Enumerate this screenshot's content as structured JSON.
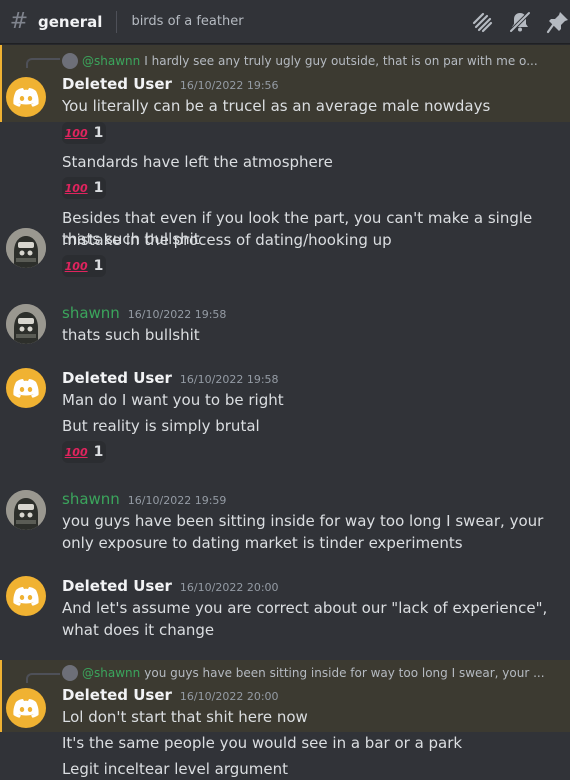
{
  "channel": {
    "name": "general",
    "topic": "birds of a feather"
  },
  "toolbar": {
    "icons": [
      "threads-icon",
      "notifications-muted-icon",
      "pin-icon"
    ]
  },
  "reactions": {
    "emoji": "100",
    "count": "1"
  },
  "messages": [
    {
      "reply": {
        "mention": "@shawnn",
        "text": "I hardly see any truly ugly guy outside, that is on par with me o..."
      },
      "author": "Deleted User",
      "time": "16/10/2022 19:56",
      "lines": [
        {
          "text": "You literally can be a trucel as an average male nowdays",
          "reaction": "1"
        },
        {
          "text": "Standards have left the atmosphere",
          "reaction": "1"
        },
        {
          "text": "Besides that even if you look the part, you can't make a single mistake in the process of dating/hooking up",
          "reaction": "1"
        }
      ]
    },
    {
      "author": "shawnn",
      "time": "16/10/2022 19:58",
      "lines": [
        {
          "text": "thats such bullshit"
        }
      ]
    },
    {
      "author": "Deleted User",
      "time": "16/10/2022 19:58",
      "lines": [
        {
          "text": "Man do I want you to be right"
        },
        {
          "text": "But reality is simply brutal",
          "reaction": "1"
        }
      ]
    },
    {
      "author": "shawnn",
      "time": "16/10/2022 19:59",
      "lines": [
        {
          "text": "you guys have been sitting inside for way too long I swear, your only exposure to dating market is tinder experiments"
        }
      ]
    },
    {
      "author": "Deleted User",
      "time": "16/10/2022 20:00",
      "lines": [
        {
          "text": "And let's assume you are correct about our \"lack of experience\", what does it change"
        }
      ]
    },
    {
      "reply": {
        "mention": "@shawnn",
        "text": "you guys have been sitting inside for way too long I swear, your ..."
      },
      "author": "Deleted User",
      "time": "16/10/2022 20:00",
      "lines": [
        {
          "text": "Lol don't start that shit here now"
        },
        {
          "text": "It's the same people you would see in a bar or a park"
        },
        {
          "text": "Legit inceltear level argument"
        }
      ]
    }
  ]
}
